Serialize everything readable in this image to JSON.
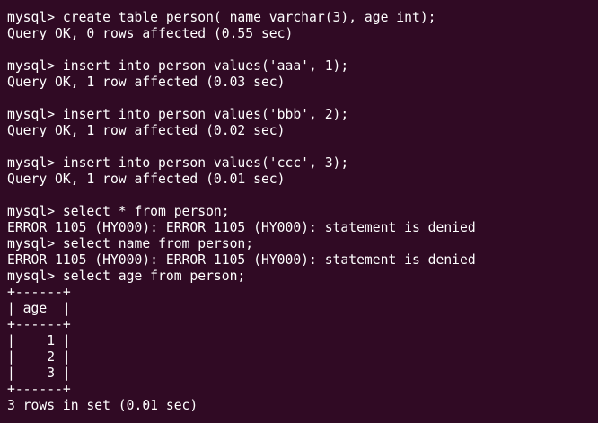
{
  "terminal": {
    "lines": [
      "mysql> create table person( name varchar(3), age int);",
      "Query OK, 0 rows affected (0.55 sec)",
      "",
      "mysql> insert into person values('aaa', 1);",
      "Query OK, 1 row affected (0.03 sec)",
      "",
      "mysql> insert into person values('bbb', 2);",
      "Query OK, 1 row affected (0.02 sec)",
      "",
      "mysql> insert into person values('ccc', 3);",
      "Query OK, 1 row affected (0.01 sec)",
      "",
      "mysql> select * from person;",
      "ERROR 1105 (HY000): ERROR 1105 (HY000): statement is denied",
      "mysql> select name from person;",
      "ERROR 1105 (HY000): ERROR 1105 (HY000): statement is denied",
      "mysql> select age from person;",
      "+------+",
      "| age  |",
      "+------+",
      "|    1 |",
      "|    2 |",
      "|    3 |",
      "+------+",
      "3 rows in set (0.01 sec)"
    ],
    "colors": {
      "background": "#300a24",
      "text": "#ffffff"
    }
  }
}
